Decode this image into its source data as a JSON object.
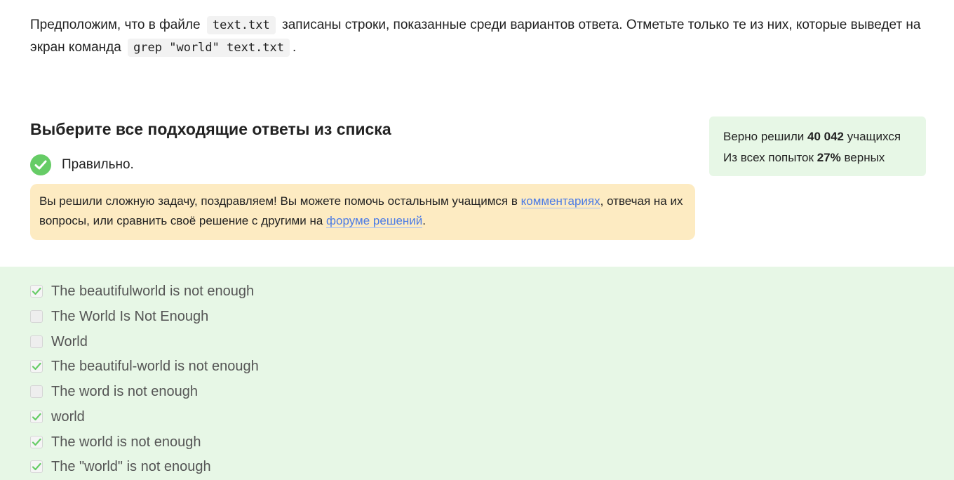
{
  "question": {
    "part1": "Предположим, что в файле",
    "code1": "text.txt",
    "part2": "записаны строки, показанные среди вариантов ответа. Отметьте только те из них, которые выведет на экран команда",
    "code2": "grep \"world\" text.txt",
    "part3": "."
  },
  "heading": "Выберите все подходящие ответы из списка",
  "result": {
    "label": "Правильно.",
    "color": "#66cc66"
  },
  "stats": {
    "line1_prefix": "Верно решили",
    "line1_value": "40 042",
    "line1_suffix": "учащихся",
    "line2_prefix": "Из всех попыток",
    "line2_value": "27%",
    "line2_suffix": "верных"
  },
  "feedback": {
    "text1": "Вы решили сложную задачу, поздравляем! Вы можете помочь остальным учащимся в",
    "link1": "комментариях",
    "text2": ", отвечая на их вопросы, или сравнить своё решение с другими на",
    "link2": "форуме решений",
    "text3": "."
  },
  "options": [
    {
      "label": "The beautifulworld is not enough",
      "checked": true
    },
    {
      "label": "The World Is Not Enough",
      "checked": false
    },
    {
      "label": "World",
      "checked": false
    },
    {
      "label": "The beautiful-world is not enough",
      "checked": true
    },
    {
      "label": "The word is not enough",
      "checked": false
    },
    {
      "label": "world",
      "checked": true
    },
    {
      "label": "The world is not enough",
      "checked": true
    },
    {
      "label": "The \"world\" is not enough",
      "checked": true
    }
  ],
  "colors": {
    "success_green": "#66cc66",
    "options_background": "#e7f7e6",
    "feedback_background": "#fdebc2",
    "link": "#4b7be5"
  }
}
